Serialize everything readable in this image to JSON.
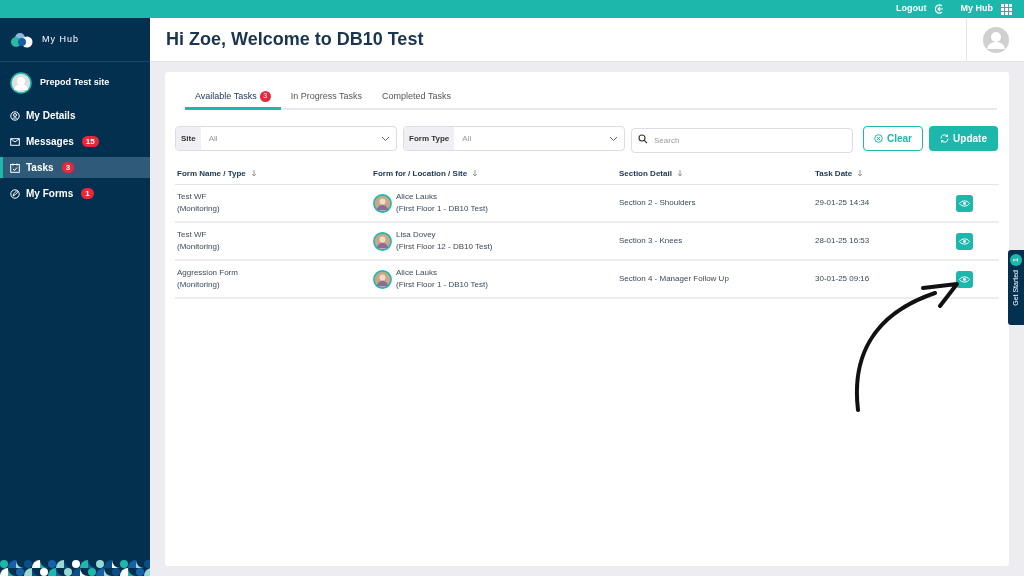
{
  "top_bar": {
    "logout": "Logout",
    "hub": "My Hub"
  },
  "sidebar": {
    "brand": "My Hub",
    "site": "Prepod Test site",
    "items": [
      {
        "label": "My Details",
        "kind": "user",
        "selected": false
      },
      {
        "label": "Messages",
        "kind": "mail",
        "badge": "15",
        "selected": false
      },
      {
        "label": "Tasks",
        "kind": "calendar",
        "badge": "3",
        "selected": true
      },
      {
        "label": "My Forms",
        "kind": "edit",
        "badge": "1",
        "selected": false
      }
    ]
  },
  "header": {
    "title": "Hi Zoe, Welcome to DB10 Test"
  },
  "tabs": [
    {
      "label": "Available Tasks",
      "badge": "3",
      "selected": true
    },
    {
      "label": "In Progress Tasks",
      "selected": false
    },
    {
      "label": "Completed Tasks",
      "selected": false
    }
  ],
  "filters": {
    "site": {
      "label": "Site",
      "value": "All"
    },
    "form_type": {
      "label": "Form Type",
      "value": "All"
    },
    "search": {
      "placeholder": "Search"
    },
    "clear": "Clear",
    "update": "Update"
  },
  "table": {
    "columns": [
      "Form Name / Type",
      "Form for / Location / Site",
      "Section Detail",
      "Task Date"
    ],
    "rows": [
      {
        "form": "Test WF",
        "type": "(Monitoring)",
        "person": "Alice Lauks",
        "location": "(First Floor 1 - DB10 Test)",
        "section": "Section 2 - Shoulders",
        "date": "29-01-25 14:34"
      },
      {
        "form": "Test WF",
        "type": "(Monitoring)",
        "person": "Lisa Dovey",
        "location": "(First Floor 12 - DB10 Test)",
        "section": "Section 3 - Knees",
        "date": "28-01-25 16:53"
      },
      {
        "form": "Aggression Form",
        "type": "(Monitoring)",
        "person": "Alice Lauks",
        "location": "(First Floor 1 - DB10 Test)",
        "section": "Section 4 - Manager Follow Up",
        "date": "30-01-25 09:16"
      }
    ]
  },
  "get_started": {
    "label": "Get Started",
    "badge": "1"
  }
}
